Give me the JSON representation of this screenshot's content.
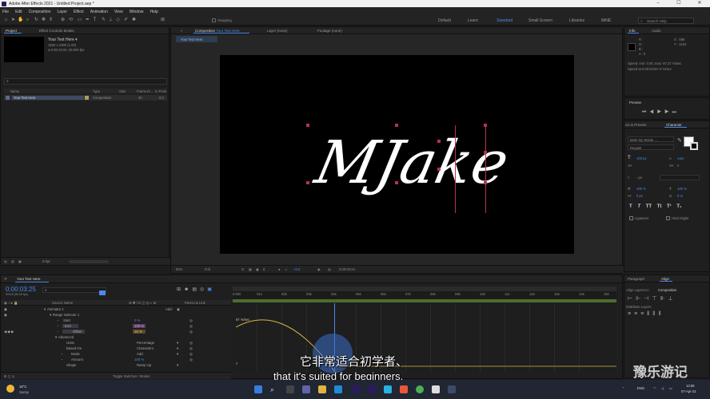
{
  "window": {
    "title": "Adobe After Effects 2021 - Untitled Project.aep *"
  },
  "menu": [
    "File",
    "Edit",
    "Composition",
    "Layer",
    "Effect",
    "Animation",
    "View",
    "Window",
    "Help"
  ],
  "toolbar": {
    "snapping_label": "Snapping",
    "workspaces": [
      "Default",
      "Learn",
      "Standard",
      "Small Screen",
      "Libraries",
      "MiNE"
    ],
    "active_workspace": "Standard",
    "search_placeholder": "Search Help"
  },
  "project_panel": {
    "tab_project": "Project",
    "tab_effect_controls": "Effect Controls MJake",
    "comp_name": "Your Text Here ▾",
    "comp_info_1": "1920 x 1080 (1.00)",
    "comp_info_2": "Δ 0:00:15:00, 30.000 fps",
    "columns": [
      "Name",
      "Type",
      "Size",
      "Frame R...",
      "In Point"
    ],
    "items": [
      {
        "name": "Your Text Here",
        "type": "Composition",
        "size": "",
        "frame_rate": "30",
        "in_point": "0:0"
      }
    ],
    "bpc": "8 bpc"
  },
  "composition_panel": {
    "tab_label": "Composition",
    "tab_comp": "Your Text Here",
    "layer_tab": "Layer (none)",
    "footage_tab": "Footage (none)",
    "subtab": "Your Text Here",
    "canvas_text": "MJake",
    "zoom": "50%",
    "resolution": "Full",
    "exposure": "+0.0",
    "timecode": "0:00:03:24"
  },
  "info_panel": {
    "tab_info": "Info",
    "tab_audio": "Audio",
    "r": "R :",
    "g": "G :",
    "b": "B :",
    "a": "A : 0",
    "x": "X : 486",
    "y": "Y : 1118",
    "speed_line1": "Speed: min: 0.00, max: 67.27 %/sec",
    "speed_line2": "Speed at 0:00:04:00: 0 %/sec"
  },
  "preview_panel": {
    "title": "Preview"
  },
  "character_panel": {
    "tab_effects": "cts & Presets",
    "tab_character": "Character",
    "font": "Mark My Words ...",
    "style": "Regular",
    "size": "100 px",
    "leading": "Auto",
    "kerning": "",
    "tracking": "0",
    "stroke": "- px",
    "vscale": "100 %",
    "hscale": "100 %",
    "baseline": "0 px",
    "tsume": "0 %",
    "style_buttons": [
      "T",
      "T",
      "TT",
      "Tt",
      "T¹",
      "T₁"
    ],
    "ligatures": "Ligatures",
    "hindi_digits": "Hindi Digits"
  },
  "paragraph_panel": {
    "tab_paragraph": "Paragraph",
    "tab_align": "Align",
    "align_layers_to": "Align Layers to:",
    "align_target": "Composition",
    "distribute_layers": "Distribute Layers"
  },
  "timeline": {
    "comp_name": "Your Text Here",
    "timecode": "0:00:03:25",
    "timecode_sub": "00115 (30.00 fps)",
    "header_cols": [
      "Source Name",
      "Parent & Link"
    ],
    "rows": [
      {
        "label": "Animator 1",
        "value": "",
        "indent": 1
      },
      {
        "label": "Range Selector 1",
        "value": "",
        "indent": 2
      },
      {
        "label": "Start",
        "value": "0 %",
        "indent": 3
      },
      {
        "label": "End",
        "value": "100 %",
        "indent": 3
      },
      {
        "label": "Offset",
        "value": "15 %",
        "indent": 3
      },
      {
        "label": "Advanced",
        "value": "",
        "indent": 2
      },
      {
        "label": "Units",
        "value": "Percentage",
        "indent": 3
      },
      {
        "label": "Based On",
        "value": "Characters",
        "indent": 3
      },
      {
        "label": "Mode",
        "value": "Add",
        "indent": 3
      },
      {
        "label": "Amount",
        "value": "100 %",
        "indent": 3
      },
      {
        "label": "Shape",
        "value": "Ramp Up",
        "indent": 3
      }
    ],
    "add_label": "Add:",
    "ruler": [
      "0:00s",
      "01s",
      "02s",
      "03s",
      "04s",
      "05s",
      "06s",
      "07s",
      "08s",
      "09s",
      "10s",
      "11s",
      "12s",
      "13s",
      "14s",
      "15s"
    ],
    "graph_value": "67 %/sec",
    "graph_zero": "0",
    "toggle_label": "Toggle Switches / Modes"
  },
  "subtitles": {
    "cn": "它非常适合初学者、",
    "en": "that it's suited for beginners,"
  },
  "watermark": "豫乐游记",
  "taskbar": {
    "weather_temp": "15°C",
    "weather_desc": "Sunny",
    "lang": "ENG",
    "time": "13:08",
    "date": "07-Apr-22"
  }
}
